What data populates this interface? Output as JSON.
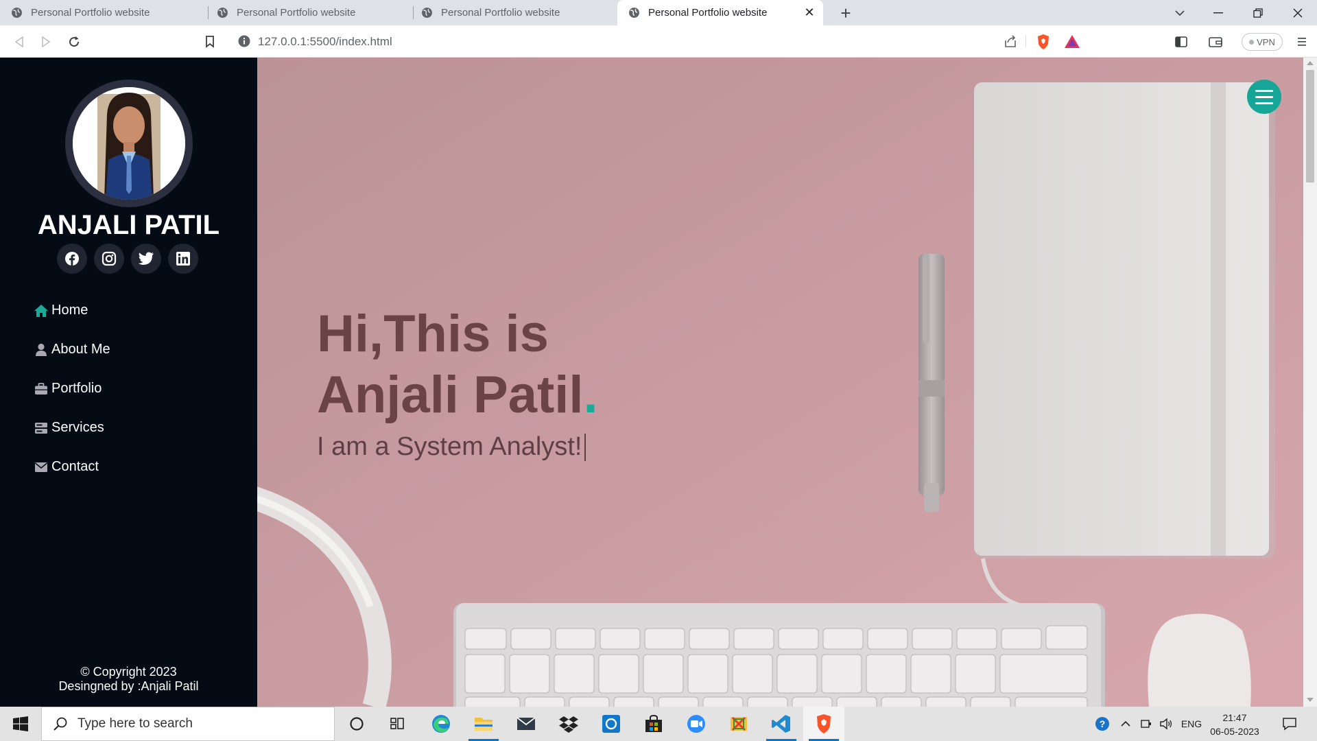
{
  "browser": {
    "tabs": [
      {
        "title": "Personal Portfolio website",
        "active": false
      },
      {
        "title": "Personal Portfolio website",
        "active": false
      },
      {
        "title": "Personal Portfolio website",
        "active": false
      },
      {
        "title": "Personal Portfolio website",
        "active": true
      }
    ],
    "new_tab_label": "+",
    "url": "127.0.0.1:5500/index.html",
    "vpn_label": "VPN"
  },
  "sidebar": {
    "name": "ANJALI PATIL",
    "socials": [
      "facebook-icon",
      "instagram-icon",
      "twitter-icon",
      "linkedin-icon"
    ],
    "nav": [
      {
        "label": "Home",
        "icon": "home-icon",
        "active": true
      },
      {
        "label": "About Me",
        "icon": "user-icon",
        "active": false
      },
      {
        "label": "Portfolio",
        "icon": "briefcase-icon",
        "active": false
      },
      {
        "label": "Services",
        "icon": "server-icon",
        "active": false
      },
      {
        "label": "Contact",
        "icon": "envelope-icon",
        "active": false
      }
    ],
    "footer_line1": "© Copyright 2023",
    "footer_line2": "Desingned by :Anjali Patil"
  },
  "hero": {
    "title_line1": "Hi,This is",
    "title_line2": "Anjali Patil",
    "title_dot": ".",
    "subtitle": "I am a System Analyst!",
    "accent_color": "#18a999",
    "background_color": "#c5979e"
  },
  "taskbar": {
    "search_placeholder": "Type here to search",
    "apps": [
      "cortana-icon",
      "task-view-icon",
      "edge-icon",
      "file-explorer-icon",
      "mail-icon",
      "dropbox-icon",
      "app-icon",
      "store-icon",
      "zoom-icon",
      "snip-icon",
      "vscode-icon",
      "brave-icon"
    ],
    "language": "ENG",
    "time": "21:47",
    "date": "06-05-2023"
  }
}
